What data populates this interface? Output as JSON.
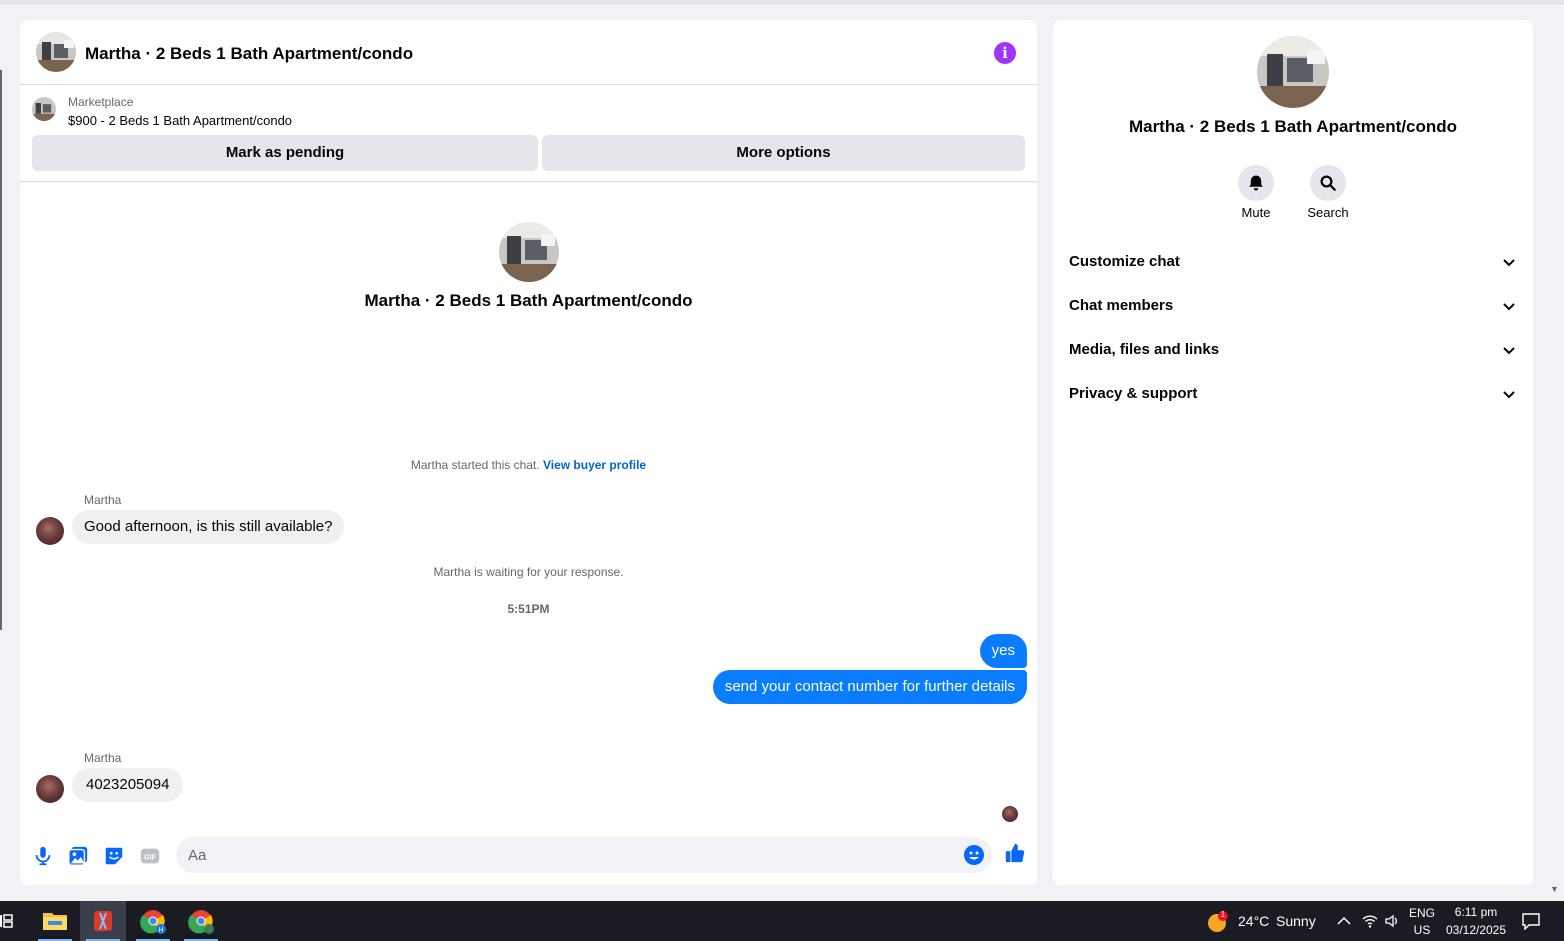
{
  "conversation": {
    "title": "Martha · 2 Beds 1 Bath Apartment/condo"
  },
  "marketplace": {
    "label": "Marketplace",
    "listing": "$900 - 2 Beds 1 Bath Apartment/condo",
    "mark_pending": "Mark as pending",
    "more_options": "More options"
  },
  "messages": {
    "started_prefix": "Martha started this chat.",
    "view_buyer_profile": "View buyer profile",
    "sender_name": "Martha",
    "msg1": "Good afternoon, is this still available?",
    "waiting": "Martha is waiting for your response.",
    "timestamp": "5:51PM",
    "out1": "yes",
    "out2": "send your contact number for further details",
    "msg2": "4023205094"
  },
  "composer": {
    "placeholder": "Aa"
  },
  "sidebar": {
    "title": "Martha · 2 Beds 1 Bath Apartment/condo",
    "mute": "Mute",
    "search": "Search",
    "sections": [
      "Customize chat",
      "Chat members",
      "Media, files and links",
      "Privacy & support"
    ]
  },
  "taskbar": {
    "weather_temp": "24°C",
    "weather_desc": "Sunny",
    "weather_badge": "1",
    "lang_top": "ENG",
    "lang_bottom": "US",
    "time": "6:11 pm",
    "date": "03/12/2025"
  },
  "colors": {
    "accent": "#0a7cff",
    "info": "#a033ff",
    "link": "#0064d1"
  }
}
